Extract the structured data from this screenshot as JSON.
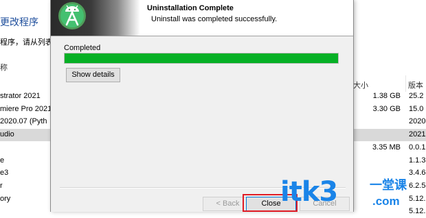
{
  "background": {
    "heading": "更改程序",
    "hint": "程序，请从列表中",
    "name_column": "称",
    "columns": {
      "size": "大小",
      "version": "版本"
    },
    "rows": [
      {
        "name": "strator 2021",
        "size": "1.38 GB",
        "version": "25.2"
      },
      {
        "name": "miere Pro 2021",
        "size": "3.30 GB",
        "version": "15.0"
      },
      {
        "name": "2020.07 (Pyth",
        "size": "",
        "version": "2020"
      },
      {
        "name": "udio",
        "size": "",
        "version": "2021",
        "selected": true
      },
      {
        "name": "",
        "size": "3.35 MB",
        "version": "0.0.1"
      },
      {
        "name": "e",
        "size": "",
        "version": "1.1.3"
      },
      {
        "name": "e3",
        "size": "",
        "version": "3.4.6"
      },
      {
        "name": "r",
        "size": "",
        "version": "6.2.5"
      },
      {
        "name": "ory",
        "size": "",
        "version": "5.12."
      },
      {
        "name": "",
        "size": "",
        "version": "5.12."
      }
    ]
  },
  "dialog": {
    "logo_icon": "android-studio-logo-icon",
    "title": "Uninstallation Complete",
    "subtitle": "Uninstall was completed successfully.",
    "status_label": "Completed",
    "progress_percent": 100,
    "progress_color": "#06b025",
    "show_details_label": "Show details",
    "back_label": "< Back",
    "close_label": "Close",
    "cancel_label": "Cancel"
  },
  "watermark": {
    "main": "itk3",
    "side": "一堂课",
    "domain": ".com"
  },
  "colors": {
    "highlight_box": "#e01b24",
    "watermark": "#1a84e8",
    "heading": "#1e4e9c"
  }
}
